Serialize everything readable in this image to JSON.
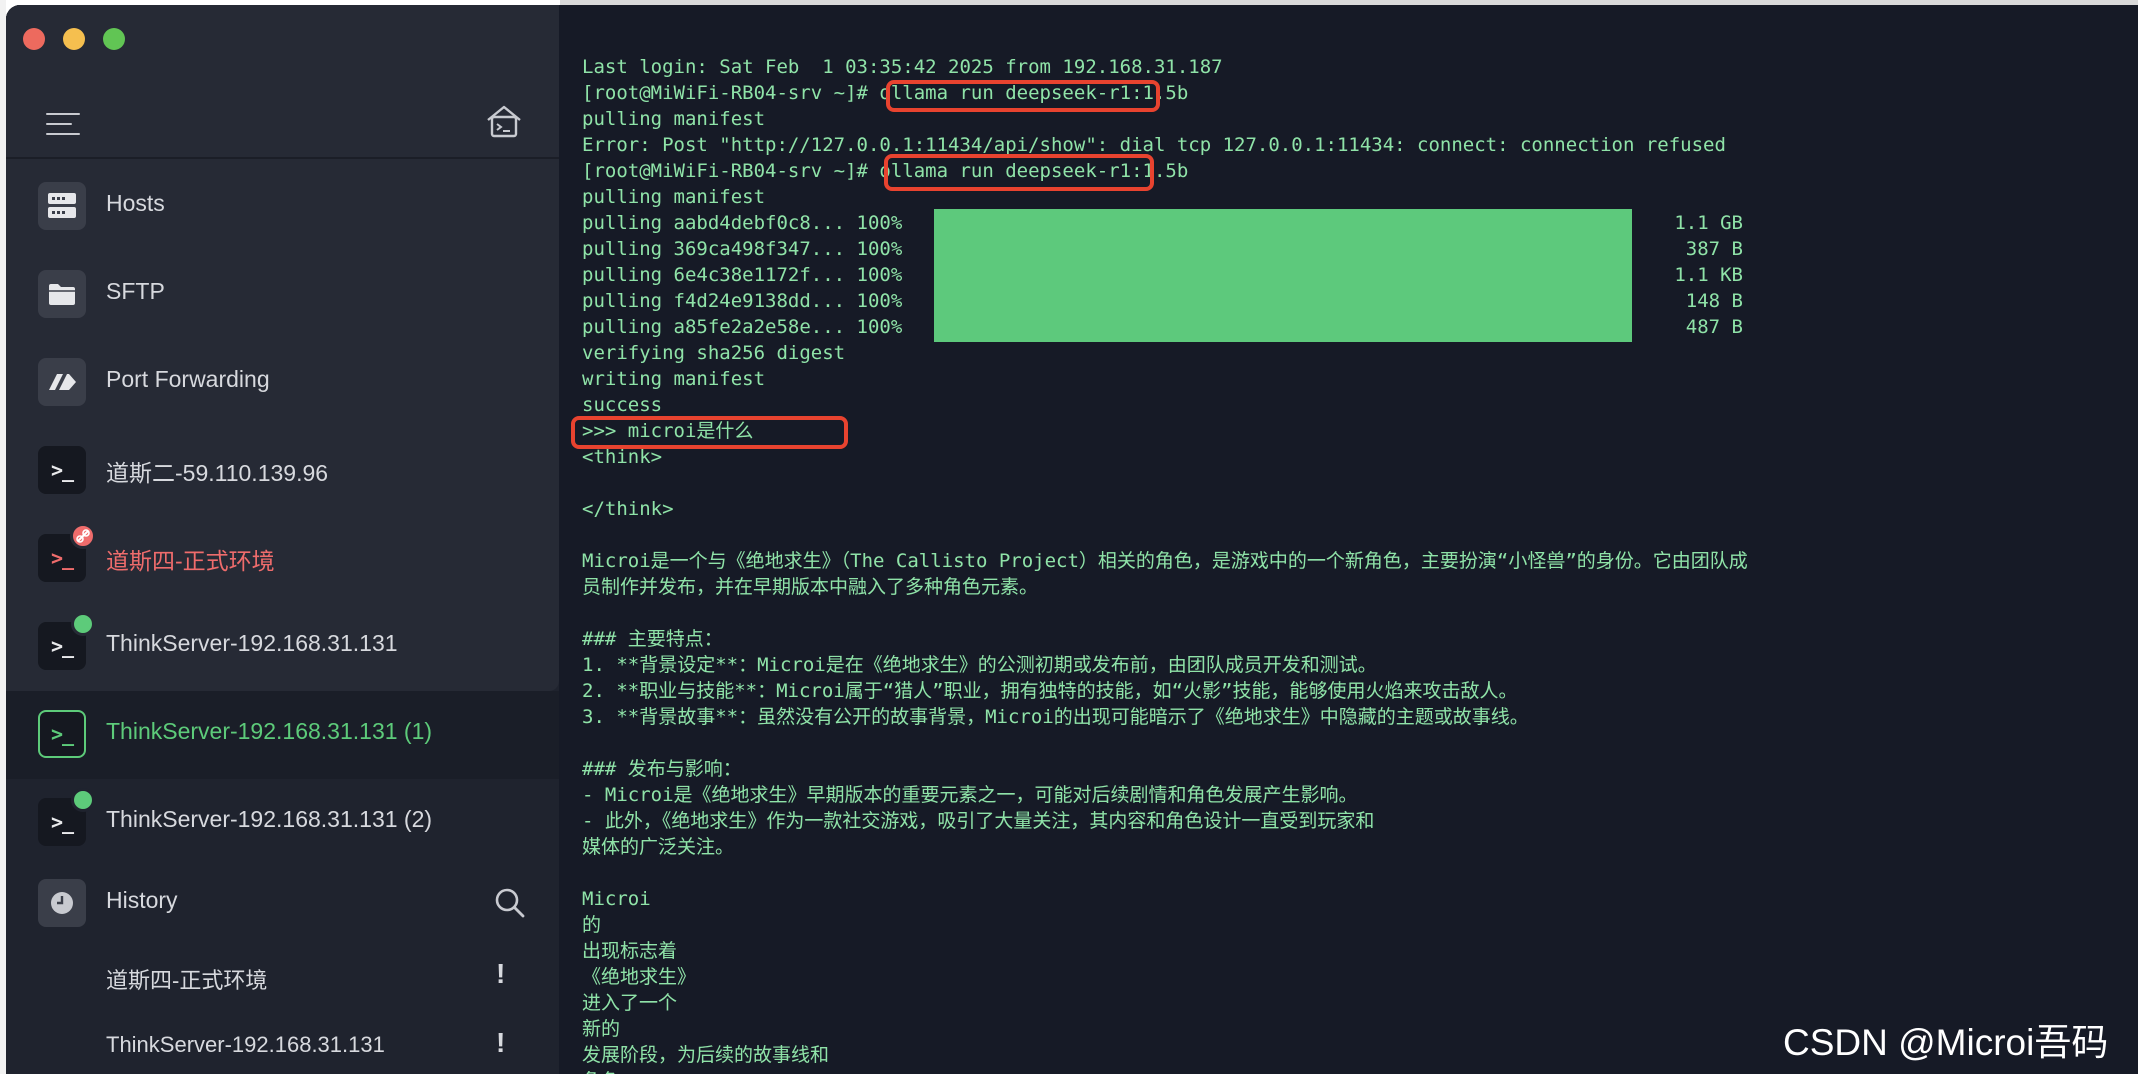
{
  "sidebar": {
    "menu_icon": "hamburger-menu-icon",
    "home_icon": "terminal-home-icon",
    "nav": [
      {
        "label": "Hosts",
        "icon": "server-icon"
      },
      {
        "label": "SFTP",
        "icon": "folder-icon"
      },
      {
        "label": "Port Forwarding",
        "icon": "port-forward-icon"
      },
      {
        "label": "道斯二-59.110.139.96",
        "icon": "terminal-icon"
      },
      {
        "label": "道斯四-正式环境",
        "icon": "terminal-icon",
        "status": "error"
      },
      {
        "label": "ThinkServer-192.168.31.131",
        "icon": "terminal-icon",
        "status": "connected"
      },
      {
        "label": "ThinkServer-192.168.31.131 (1)",
        "icon": "terminal-icon",
        "status": "active"
      },
      {
        "label": "ThinkServer-192.168.31.131 (2)",
        "icon": "terminal-icon",
        "status": "connected"
      }
    ],
    "history": {
      "label": "History",
      "icon": "clock-icon",
      "search_icon": "search-icon",
      "items": [
        {
          "label": "道斯四-正式环境",
          "mark": "!"
        },
        {
          "label": "ThinkServer-192.168.31.131",
          "mark": "!"
        }
      ]
    },
    "prompt_glyph": ">_"
  },
  "terminal": {
    "lines": [
      "Last login: Sat Feb  1 03:35:42 2025 from 192.168.31.187",
      "[root@MiWiFi-RB04-srv ~]# ollama run deepseek-r1:1.5b",
      "pulling manifest",
      "Error: Post \"http://127.0.0.1:11434/api/show\": dial tcp 127.0.0.1:11434: connect: connection refused",
      "[root@MiWiFi-RB04-srv ~]# ollama run deepseek-r1:1.5b",
      "pulling manifest",
      "pulling aabd4debf0c8... 100%",
      "pulling 369ca498f347... 100%",
      "pulling 6e4c38e1172f... 100%",
      "pulling f4d24e9138dd... 100%",
      "pulling a85fe2a2e58e... 100%",
      "verifying sha256 digest",
      "writing manifest",
      "success",
      ">>> microi是什么",
      "<think>",
      "",
      "</think>",
      "",
      "Microi是一个与《绝地求生》（The Callisto Project）相关的角色，是游戏中的一个新角色，主要扮演“小怪兽”的身份。它由团队成",
      "员制作并发布，并在早期版本中融入了多种角色元素。",
      "",
      "### 主要特点：",
      "1. **背景设定**：Microi是在《绝地求生》的公测初期或发布前，由团队成员开发和测试。",
      "2. **职业与技能**：Microi属于“猎人”职业，拥有独特的技能，如“火影”技能，能够使用火焰来攻击敌人。",
      "3. **背景故事**：虽然没有公开的故事背景，Microi的出现可能暗示了《绝地求生》中隐藏的主题或故事线。",
      "",
      "### 发布与影响：",
      "- Microi是《绝地求生》早期版本的重要元素之一，可能对后续剧情和角色发展产生影响。",
      "- 此外，《绝地求生》作为一款社交游戏，吸引了大量关注，其内容和角色设计一直受到玩家和",
      "媒体的广泛关注。",
      "",
      "Microi",
      "的",
      "出现标志着",
      "《绝地求生》",
      "进入了一个",
      "新的",
      "发展阶段，为后续的故事线和",
      "角色"
    ],
    "progress": [
      {
        "percent": 100,
        "size": "1.1 GB"
      },
      {
        "percent": 100,
        "size": "387 B"
      },
      {
        "percent": 100,
        "size": "1.1 KB"
      },
      {
        "percent": 100,
        "size": "148 B"
      },
      {
        "percent": 100,
        "size": "487 B"
      }
    ]
  },
  "colors": {
    "accent_green": "#5dcb7a",
    "error_red": "#ef6c6c",
    "highlight_red": "#e8432f"
  },
  "watermark": "CSDN @Microi吾码"
}
